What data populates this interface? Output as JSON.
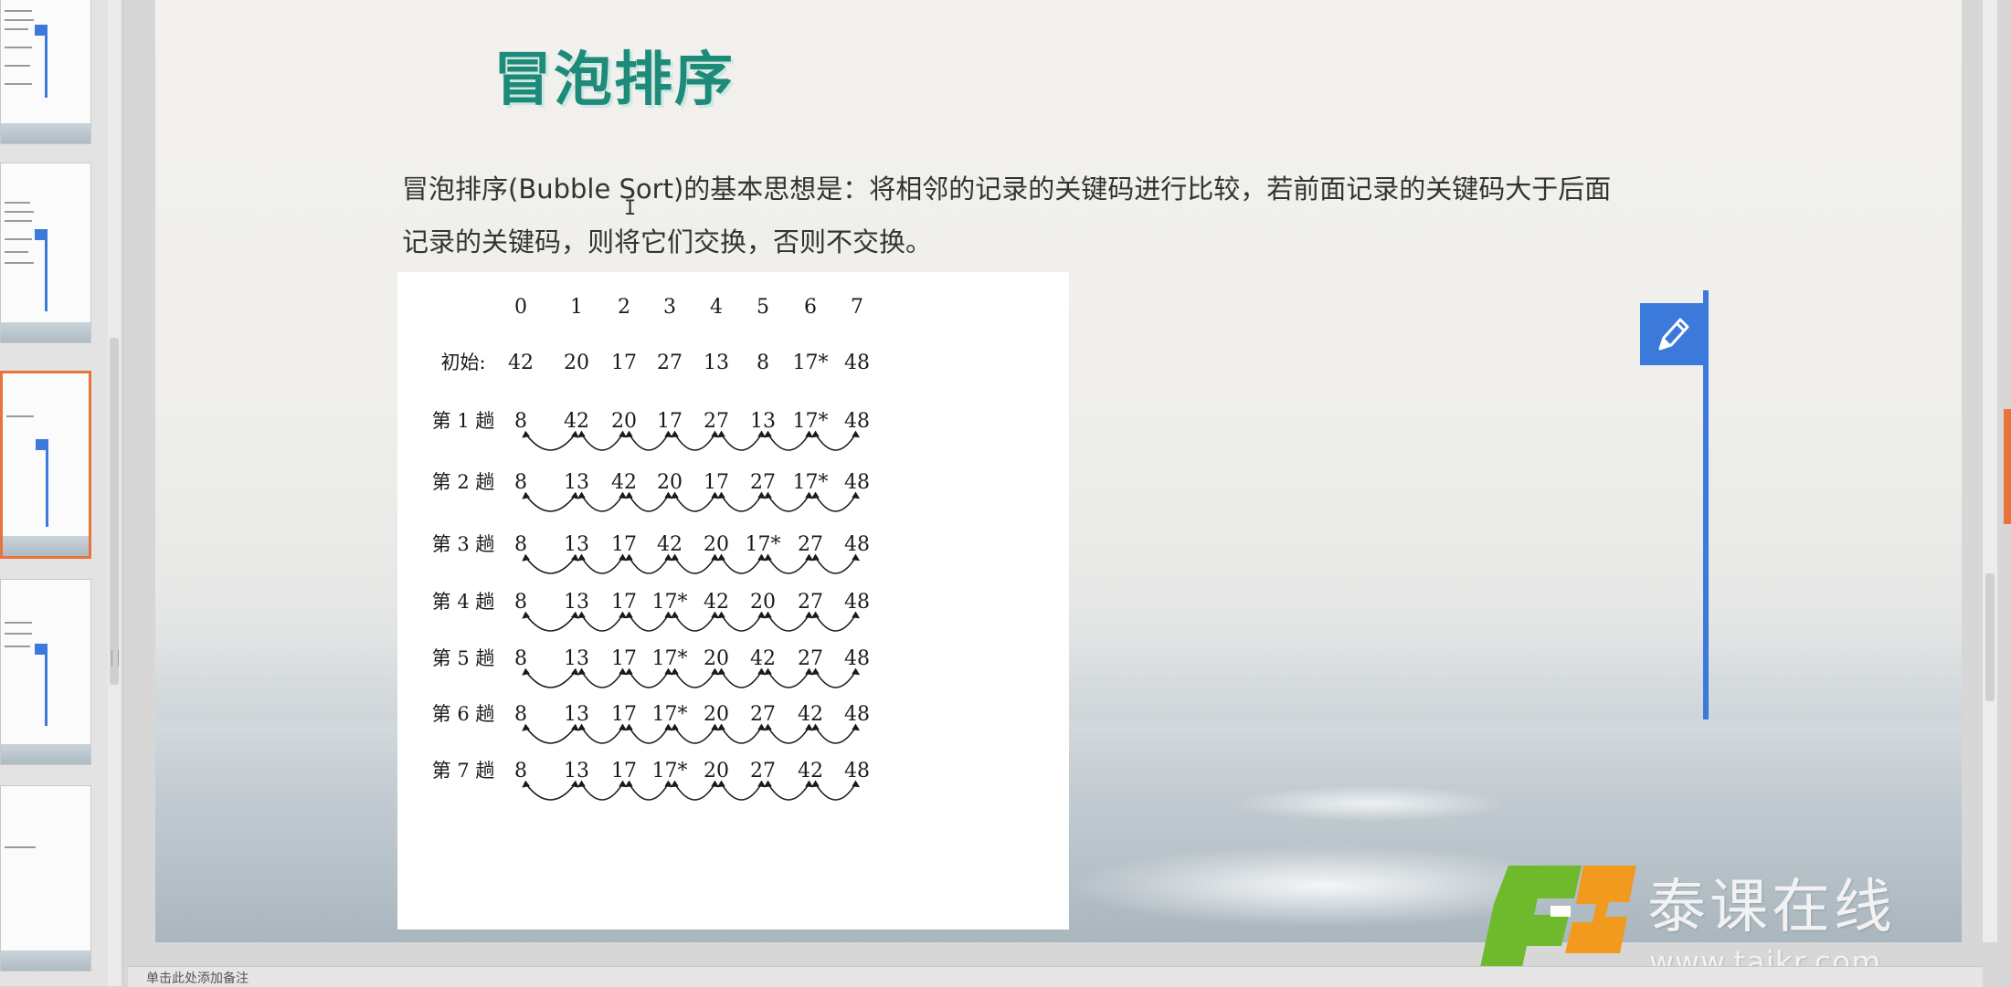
{
  "slide": {
    "title": "冒泡排序",
    "paragraph": "冒泡排序(Bubble Sort)的基本思想是：将相邻的记录的关键码进行比较，若前面记录的关键码大于后面记录的关键码，则将它们交换，否则不交换。",
    "cursor": "I"
  },
  "diagram": {
    "indices": [
      "0",
      "1",
      "2",
      "3",
      "4",
      "5",
      "6",
      "7"
    ],
    "rows": [
      {
        "label": "初始:",
        "values": [
          "42",
          "20",
          "17",
          "27",
          "13",
          "8",
          "17*",
          "48"
        ],
        "arcs": false
      },
      {
        "label": "第 1 趟",
        "values": [
          "8",
          "42",
          "20",
          "17",
          "27",
          "13",
          "17*",
          "48"
        ],
        "arcs": true
      },
      {
        "label": "第 2 趟",
        "values": [
          "8",
          "13",
          "42",
          "20",
          "17",
          "27",
          "17*",
          "48"
        ],
        "arcs": true
      },
      {
        "label": "第 3 趟",
        "values": [
          "8",
          "13",
          "17",
          "42",
          "20",
          "17*",
          "27",
          "48"
        ],
        "arcs": true
      },
      {
        "label": "第 4 趟",
        "values": [
          "8",
          "13",
          "17",
          "17*",
          "42",
          "20",
          "27",
          "48"
        ],
        "arcs": true
      },
      {
        "label": "第 5 趟",
        "values": [
          "8",
          "13",
          "17",
          "17*",
          "20",
          "42",
          "27",
          "48"
        ],
        "arcs": true
      },
      {
        "label": "第 6 趟",
        "values": [
          "8",
          "13",
          "17",
          "17*",
          "20",
          "27",
          "42",
          "48"
        ],
        "arcs": true
      },
      {
        "label": "第 7 趟",
        "values": [
          "8",
          "13",
          "17",
          "17*",
          "20",
          "27",
          "42",
          "48"
        ],
        "arcs": true
      }
    ]
  },
  "logo": {
    "name": "泰课在线",
    "url": "www.taikr.com",
    "colors": {
      "green": "#6fba2c",
      "orange": "#f29a1e"
    }
  },
  "notes": {
    "placeholder": "单击此处添加备注"
  },
  "colors": {
    "accent": "#3b79db",
    "title": "#1e8b7a",
    "active_thumb": "#e8743b"
  },
  "icons": {
    "pen": "pencil-icon",
    "cursor": "text-cursor-icon"
  }
}
